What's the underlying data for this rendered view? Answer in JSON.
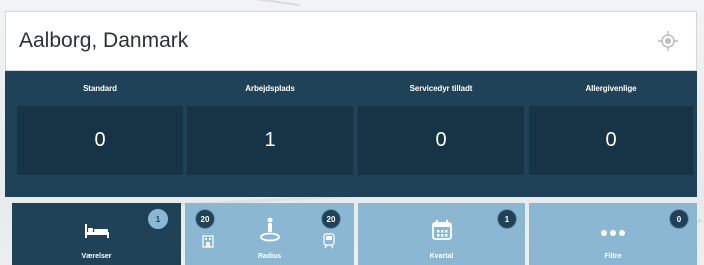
{
  "search": {
    "location": "Aalborg, Danmark",
    "locate_icon": "crosshair-target-icon"
  },
  "stats": [
    {
      "label": "Standard",
      "value": "0"
    },
    {
      "label": "Arbejdsplads",
      "value": "1"
    },
    {
      "label": "Servicedyr tilladt",
      "value": "0"
    },
    {
      "label": "Allergivenlige",
      "value": "0"
    }
  ],
  "tiles": {
    "rooms": {
      "label": "Værelser",
      "badge": "1",
      "icon": "bed-icon"
    },
    "radius": {
      "label": "Radius",
      "badge_left": "20",
      "badge_right": "20",
      "icon": "person-pin-icon",
      "left_icon": "building-icon",
      "right_icon": "train-icon"
    },
    "quarter": {
      "label": "Kvartal",
      "badge": "1",
      "icon": "calendar-icon"
    },
    "filters": {
      "label": "Filtre",
      "badge": "0",
      "icon": "more-dots-icon"
    }
  },
  "colors": {
    "panel": "#1f4258",
    "stat_box": "#173446",
    "tile_light": "#8cb7d3"
  }
}
